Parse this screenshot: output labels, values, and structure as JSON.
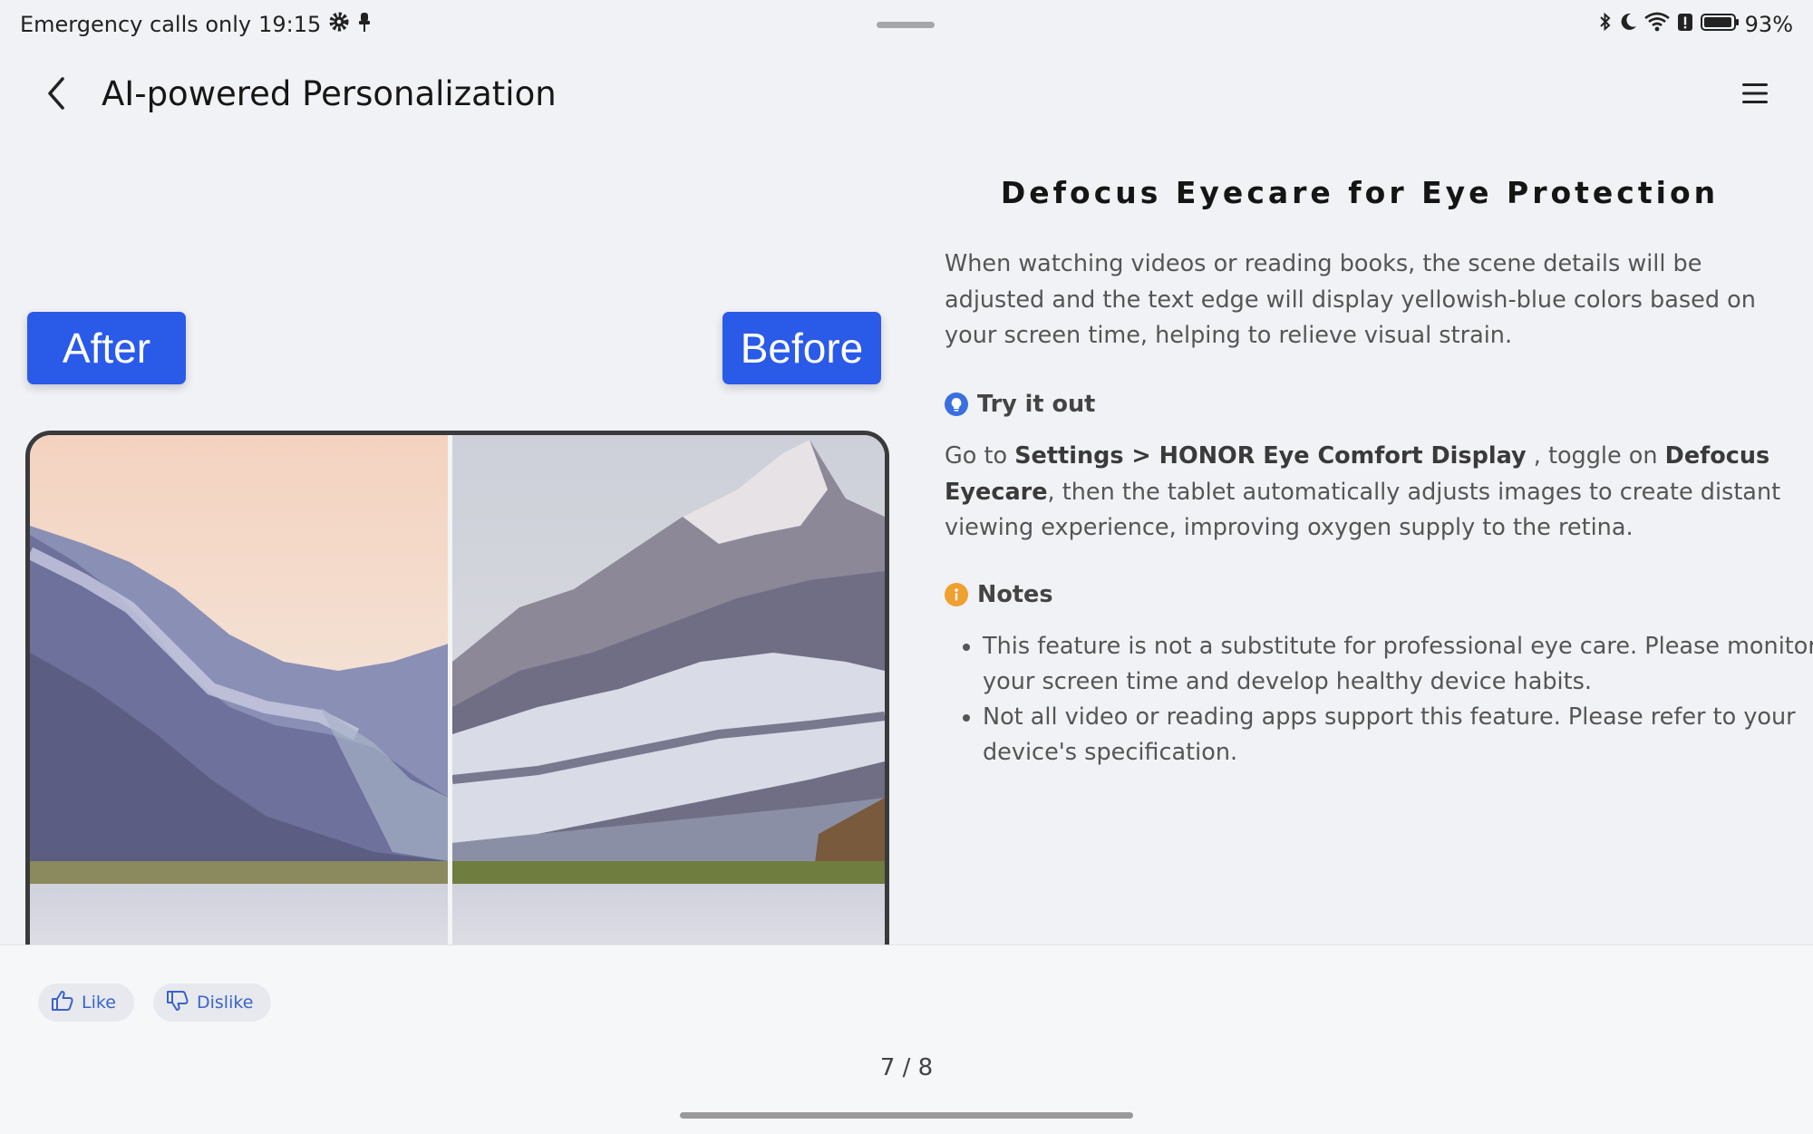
{
  "status_bar": {
    "carrier_text": "Emergency calls only",
    "time": "19:15",
    "battery": "93%",
    "left_icons": [
      "gear-icon",
      "pin-icon"
    ],
    "right_icons": [
      "bluetooth-icon",
      "moon-icon",
      "wifi-icon",
      "alert-icon",
      "battery-icon"
    ]
  },
  "header": {
    "title": "AI-powered Personalization",
    "back_icon": "chevron-left-icon",
    "menu_icon": "hamburger-menu-icon"
  },
  "comparison": {
    "after_label": "After",
    "before_label": "Before"
  },
  "content": {
    "title": "Defocus Eyecare for Eye Protection",
    "description": "When watching videos or reading books, the scene details will be adjusted and the text edge will display yellowish-blue colors based on your screen time, helping to relieve visual strain.",
    "try_heading": "Try it out",
    "try_text": {
      "prefix": "Go to ",
      "path": "Settings > HONOR Eye Comfort Display",
      "middle": " , toggle on ",
      "feature": "Defocus Eyecare",
      "suffix": ", then the tablet automatically adjusts images to create distant viewing experience, improving oxygen supply to the retina."
    },
    "notes_heading": "Notes",
    "notes": [
      "This feature is not a substitute for professional eye care. Please monitor your screen time and develop healthy device habits.",
      "Not all video or reading apps support this feature. Please refer to your device's specification."
    ]
  },
  "footer": {
    "like_label": "Like",
    "dislike_label": "Dislike",
    "page_indicator": "7 / 8"
  },
  "colors": {
    "accent": "#2a5ae8",
    "try_icon": "#3a6fe0",
    "notes_icon": "#f0a030",
    "background": "#f1f2f6"
  }
}
